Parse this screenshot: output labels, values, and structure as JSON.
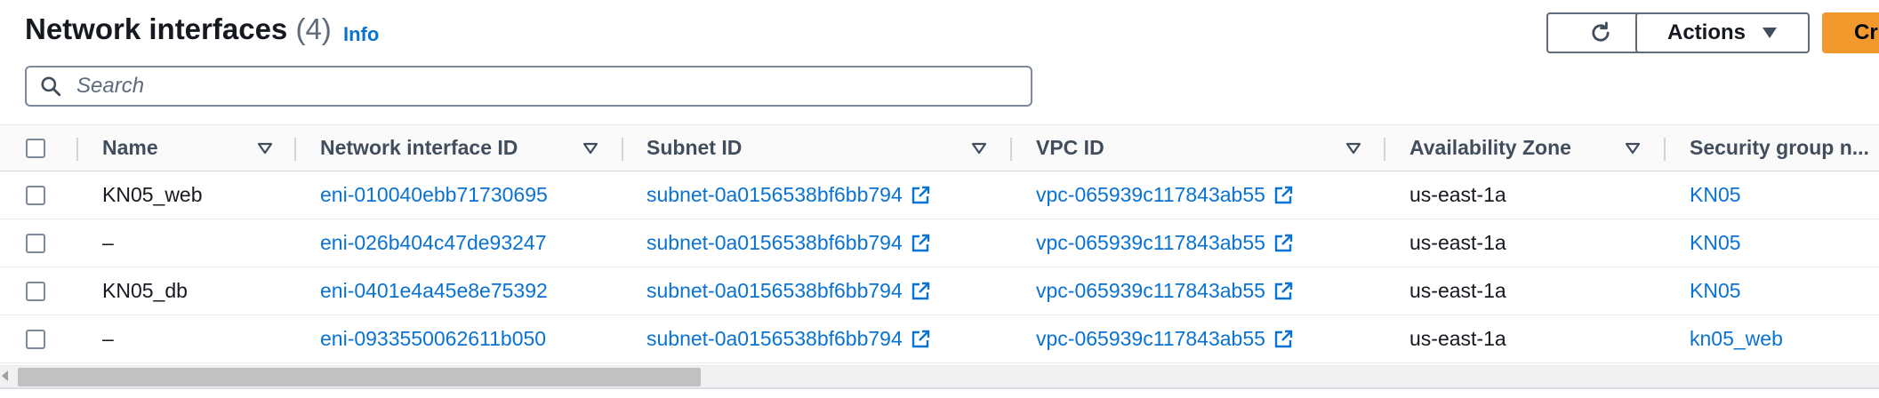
{
  "header": {
    "title": "Network interfaces",
    "count": "(4)",
    "info_label": "Info",
    "actions_label": "Actions",
    "create_label": "Cr"
  },
  "search": {
    "placeholder": "Search",
    "value": ""
  },
  "table": {
    "columns": [
      "Name",
      "Network interface ID",
      "Subnet ID",
      "VPC ID",
      "Availability Zone",
      "Security group n..."
    ],
    "rows": [
      {
        "name": "KN05_web",
        "eni": "eni-010040ebb71730695",
        "subnet": "subnet-0a0156538bf6bb794",
        "vpc": "vpc-065939c117843ab55",
        "az": "us-east-1a",
        "sg": "KN05"
      },
      {
        "name": "–",
        "eni": "eni-026b404c47de93247",
        "subnet": "subnet-0a0156538bf6bb794",
        "vpc": "vpc-065939c117843ab55",
        "az": "us-east-1a",
        "sg": "KN05"
      },
      {
        "name": "KN05_db",
        "eni": "eni-0401e4a45e8e75392",
        "subnet": "subnet-0a0156538bf6bb794",
        "vpc": "vpc-065939c117843ab55",
        "az": "us-east-1a",
        "sg": "KN05"
      },
      {
        "name": "–",
        "eni": "eni-0933550062611b050",
        "subnet": "subnet-0a0156538bf6bb794",
        "vpc": "vpc-065939c117843ab55",
        "az": "us-east-1a",
        "sg": "kn05_web"
      }
    ]
  },
  "icons": {
    "refresh": "refresh-icon",
    "dropdown": "caret-down-icon",
    "search": "search-icon",
    "sort": "sort-icon",
    "external": "external-link-icon"
  },
  "colors": {
    "link": "#0972d3",
    "primary_button": "#f2992d",
    "text": "#16191f",
    "header_text": "#414d5c"
  }
}
